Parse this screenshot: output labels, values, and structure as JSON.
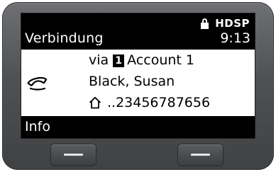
{
  "header": {
    "title": "Verbindung",
    "status_icon": "lock-icon",
    "hdsp_label": "HDSP",
    "time": "9:13"
  },
  "call": {
    "status_icon": "handset-icon",
    "via_label": "via",
    "account_number": "1",
    "account_name": "Account 1",
    "contact_name": "Black, Susan",
    "number_type_icon": "home-icon",
    "number": "..23456787656"
  },
  "softkeys": {
    "left_label": "Info",
    "right_label": ""
  }
}
